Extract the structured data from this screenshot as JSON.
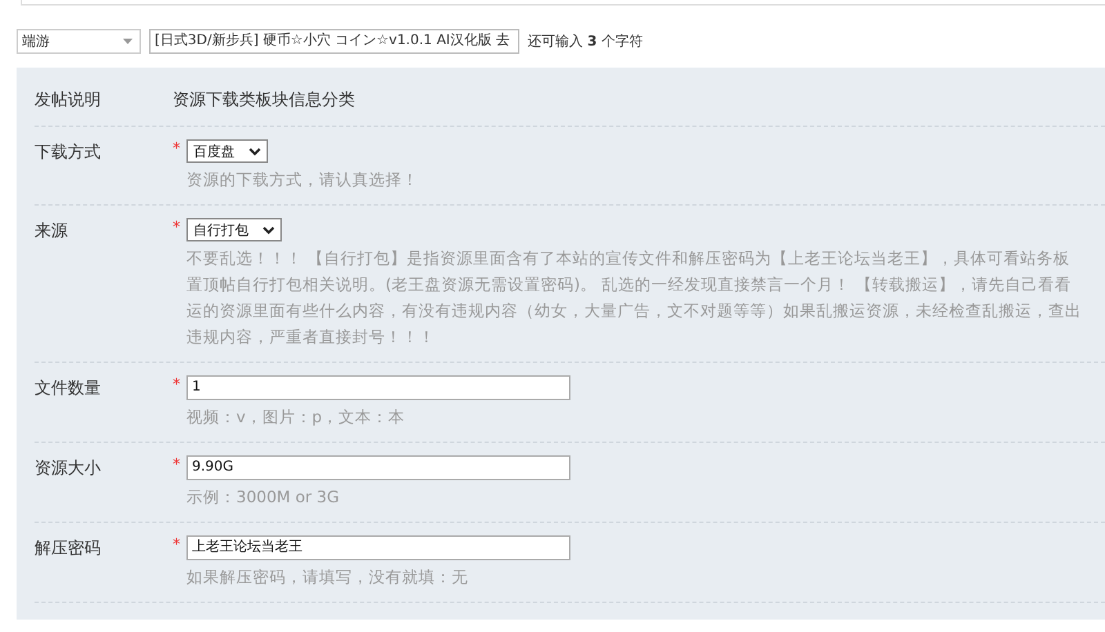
{
  "top_bar": {
    "category_select": {
      "value": "端游"
    },
    "title_input": {
      "value": "[日式3D/新步兵] 硬币☆小穴 コイン☆v1.0.1 AI汉化版 去"
    },
    "remaining_note": "还可输入 **3** 个字符"
  },
  "form": {
    "intro": {
      "label": "发帖说明",
      "text": "资源下载类板块信息分类"
    },
    "rows": [
      {
        "label": "下载方式",
        "kind": "select",
        "required_mark": "*",
        "value": "百度盘",
        "hint_lines": [
          "资源的下载方式，请认真选择！"
        ]
      },
      {
        "label": "来源",
        "kind": "select",
        "required_mark": "*",
        "value": "自行打包",
        "hint_lines": [
          "不要乱选！！！ 【自行打包】是指资源里面含有了本站的宣传文件和解压密码为【上老王论坛当老王】，具体可看站务板",
          "置顶帖自行打包相关说明。(老王盘资源无需设置密码)。 乱选的一经发现直接禁言一个月！ 【转载搬运】，请先自己看看",
          "运的资源里面有些什么内容，有没有违规内容（幼女，大量广告，文不对题等等）如果乱搬运资源，未经检查乱搬运，查出",
          "违规内容，严重者直接封号！！！"
        ]
      },
      {
        "label": "文件数量",
        "kind": "text",
        "required_mark": "*",
        "value": "1",
        "hint_lines": [
          "视频：v，图片：p，文本：本"
        ]
      },
      {
        "label": "资源大小",
        "kind": "text",
        "required_mark": "*",
        "value": "9.90G",
        "hint_lines": [
          "示例：3000M or 3G"
        ]
      },
      {
        "label": "解压密码",
        "kind": "text",
        "required_mark": "*",
        "value": "上老王论坛当老王",
        "hint_lines": [
          "如果解压密码，请填写，没有就填：无"
        ]
      }
    ]
  }
}
